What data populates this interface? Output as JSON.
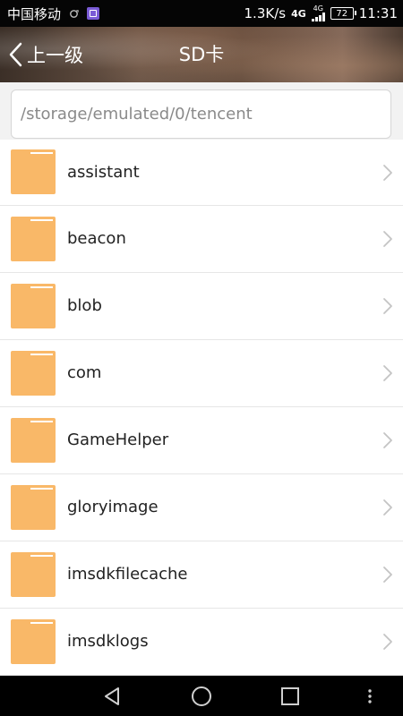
{
  "status_bar": {
    "carrier": "中国移动",
    "speed": "1.3K/s",
    "network_4g": "4G",
    "network_4g_small": "4G",
    "battery": "72",
    "time": "11:31"
  },
  "header": {
    "back_label": "上一级",
    "title": "SD卡"
  },
  "path_field": {
    "value": "/storage/emulated/0/tencent"
  },
  "files": [
    {
      "name": "assistant"
    },
    {
      "name": "beacon"
    },
    {
      "name": "blob"
    },
    {
      "name": "com"
    },
    {
      "name": "GameHelper"
    },
    {
      "name": "gloryimage"
    },
    {
      "name": "imsdkfilecache"
    },
    {
      "name": "imsdklogs"
    }
  ],
  "colors": {
    "folder": "#f9b868",
    "folder_tab": "#ffffff",
    "chevron": "#c4c4c4"
  }
}
